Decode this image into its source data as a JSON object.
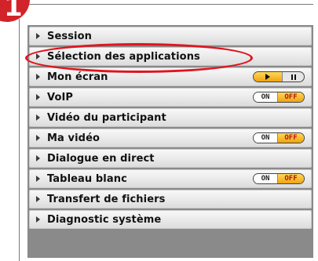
{
  "step": {
    "number": "1",
    "color": "#d2232a"
  },
  "highlight_color": "#e0141e",
  "panel": {
    "items": [
      {
        "label": "Session",
        "control": "none"
      },
      {
        "label": "Sélection des applications",
        "control": "none",
        "highlighted": true
      },
      {
        "label": "Mon écran",
        "control": "play-pause"
      },
      {
        "label": "VoIP",
        "control": "toggle",
        "on_label": "ON",
        "off_label": "OFF",
        "state": "off"
      },
      {
        "label": "Vidéo du participant",
        "control": "none"
      },
      {
        "label": "Ma vidéo",
        "control": "toggle",
        "on_label": "ON",
        "off_label": "OFF",
        "state": "off"
      },
      {
        "label": "Dialogue en direct",
        "control": "none"
      },
      {
        "label": "Tableau blanc",
        "control": "toggle",
        "on_label": "ON",
        "off_label": "OFF",
        "state": "off"
      },
      {
        "label": "Transfert de fichiers",
        "control": "none"
      },
      {
        "label": "Diagnostic système",
        "control": "none"
      }
    ]
  },
  "icons": {
    "expand": "chevron-right-icon",
    "play": "play-icon",
    "pause": "pause-icon"
  }
}
